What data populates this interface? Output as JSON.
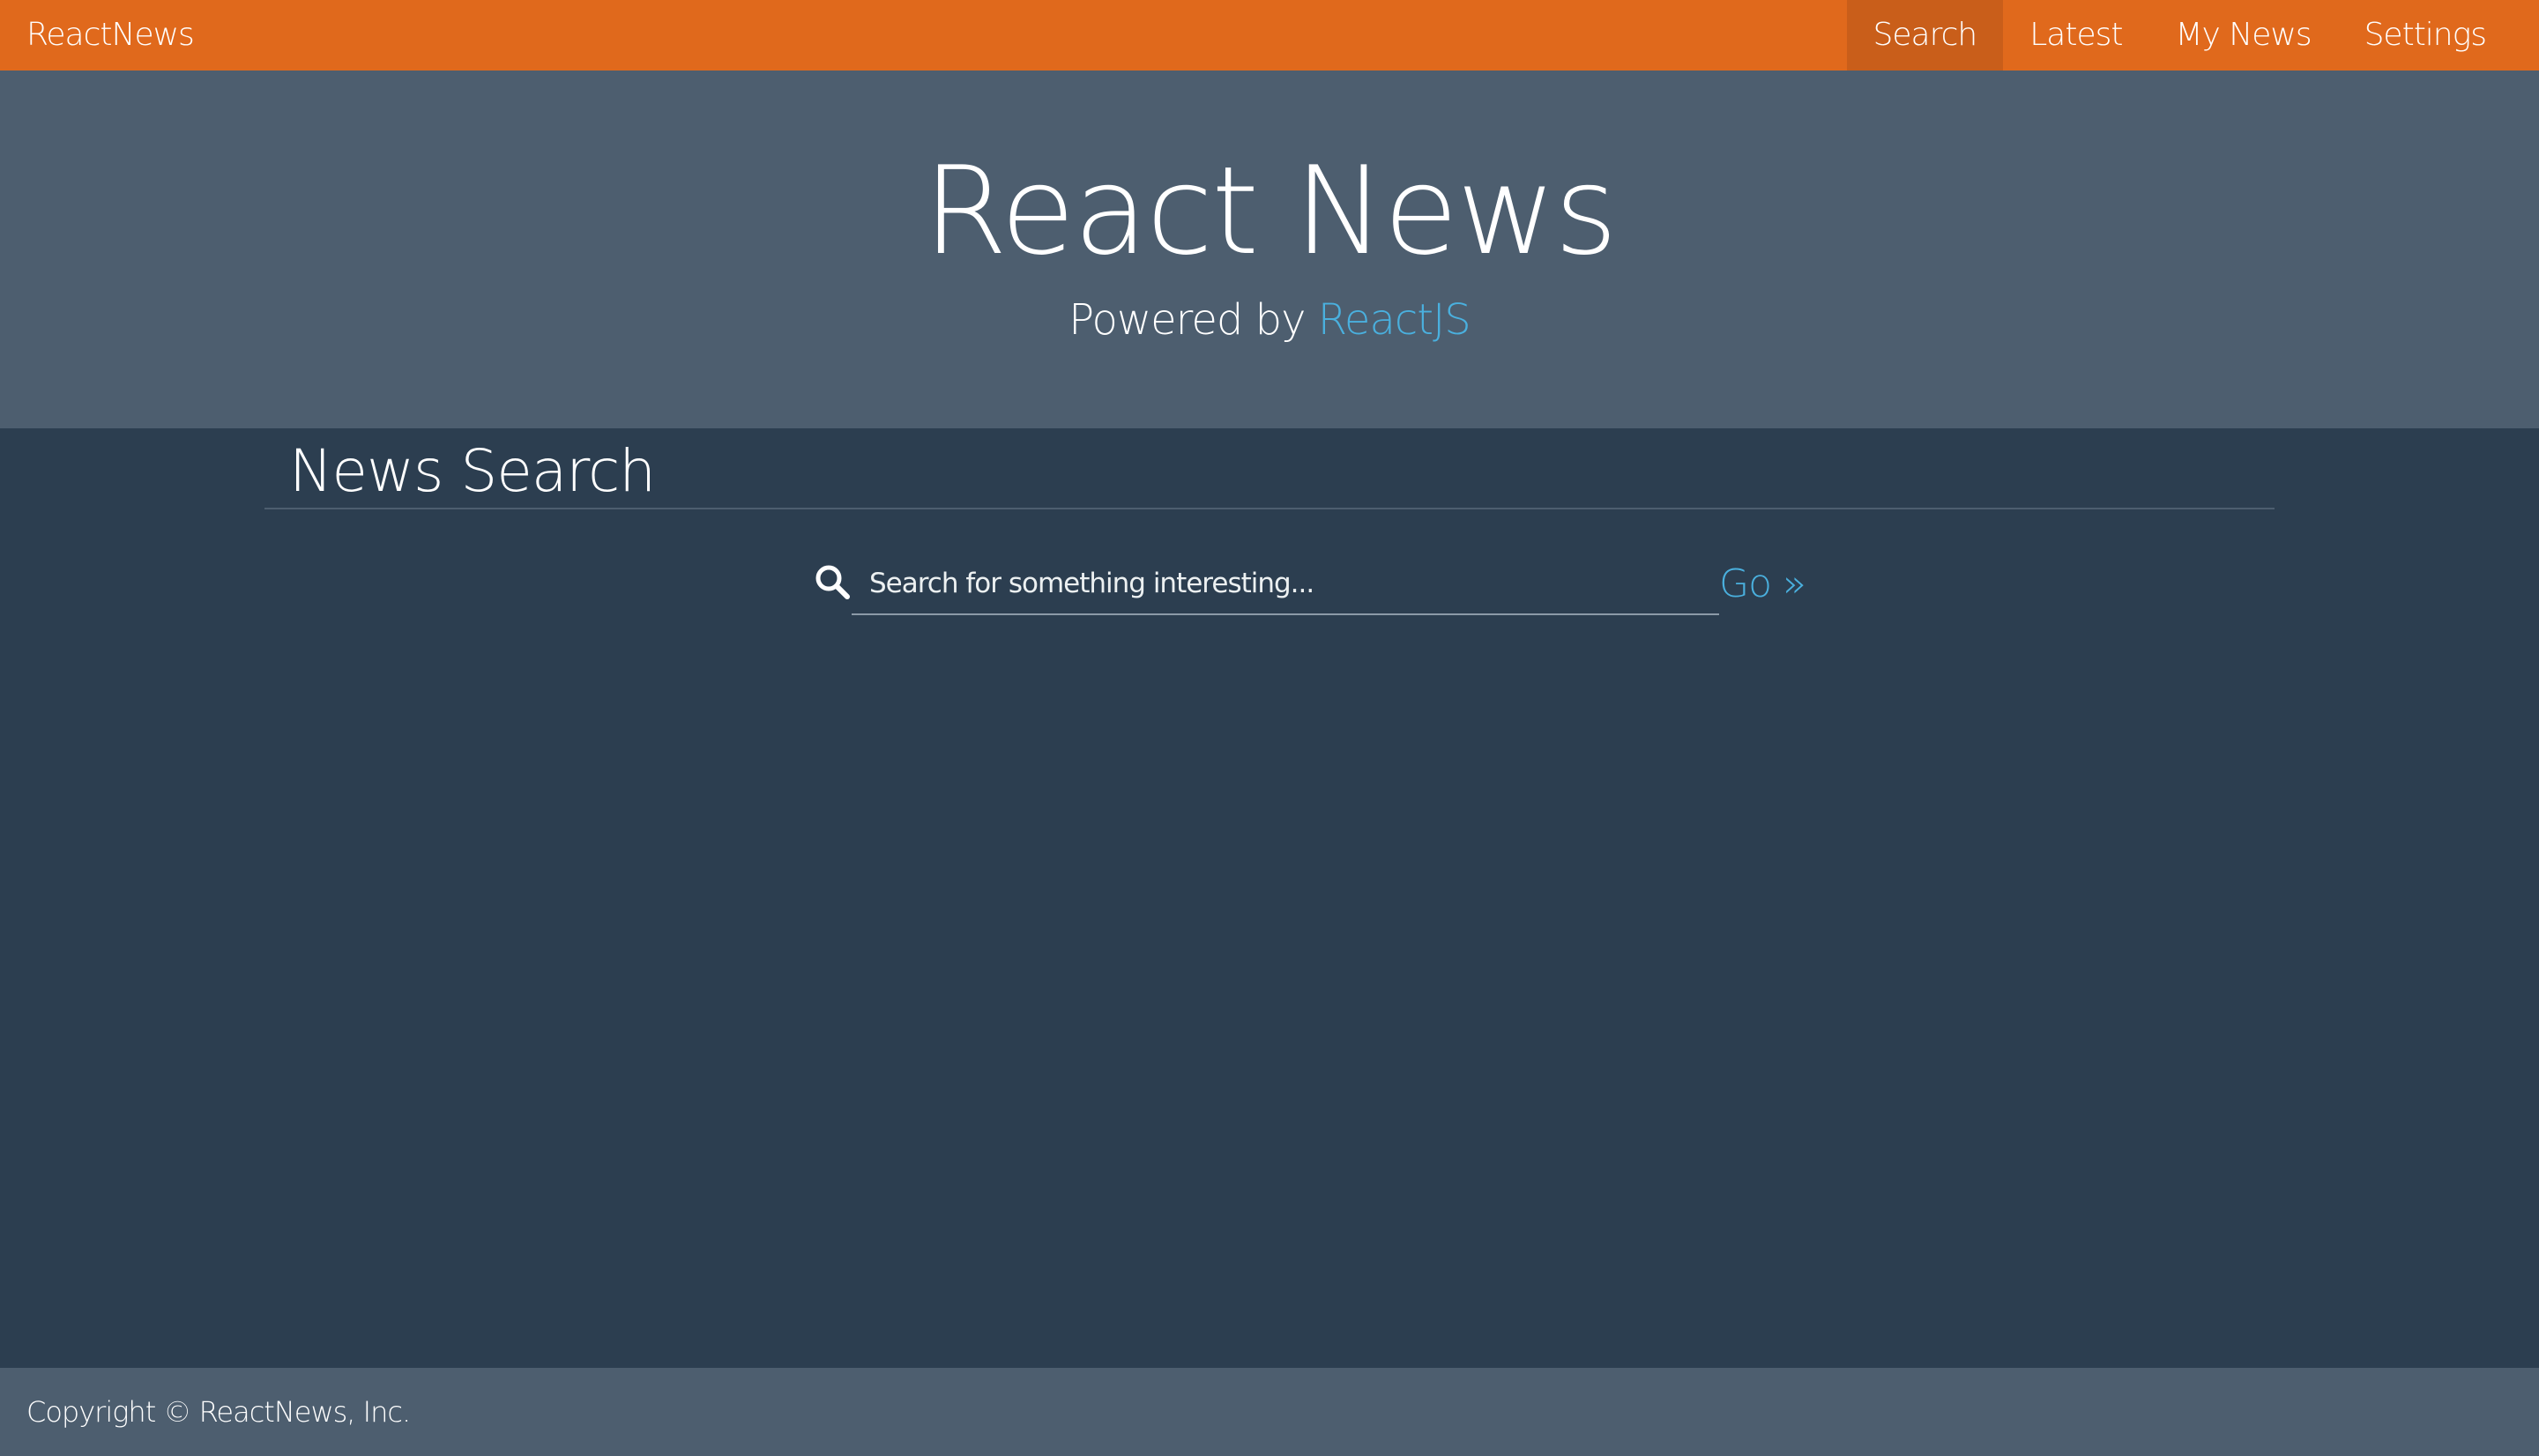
{
  "navbar": {
    "brand": "ReactNews",
    "items": [
      {
        "label": "Search",
        "active": true
      },
      {
        "label": "Latest",
        "active": false
      },
      {
        "label": "My News",
        "active": false
      },
      {
        "label": "Settings",
        "active": false
      }
    ]
  },
  "hero": {
    "title": "React News",
    "subtitle_prefix": "Powered by ",
    "subtitle_link": "ReactJS"
  },
  "main": {
    "section_title": "News Search",
    "search": {
      "placeholder": "Search for something interesting...",
      "value": "",
      "icon": "search-icon"
    },
    "go_label": "Go »"
  },
  "footer": {
    "text": "Copyright © ReactNews, Inc."
  },
  "colors": {
    "navbar": "#e0691c",
    "navbar_active": "#c95e1a",
    "hero": "#4d5e6f",
    "body": "#2c3e50",
    "accent": "#4ab0de",
    "footer": "#4d5e6f"
  }
}
